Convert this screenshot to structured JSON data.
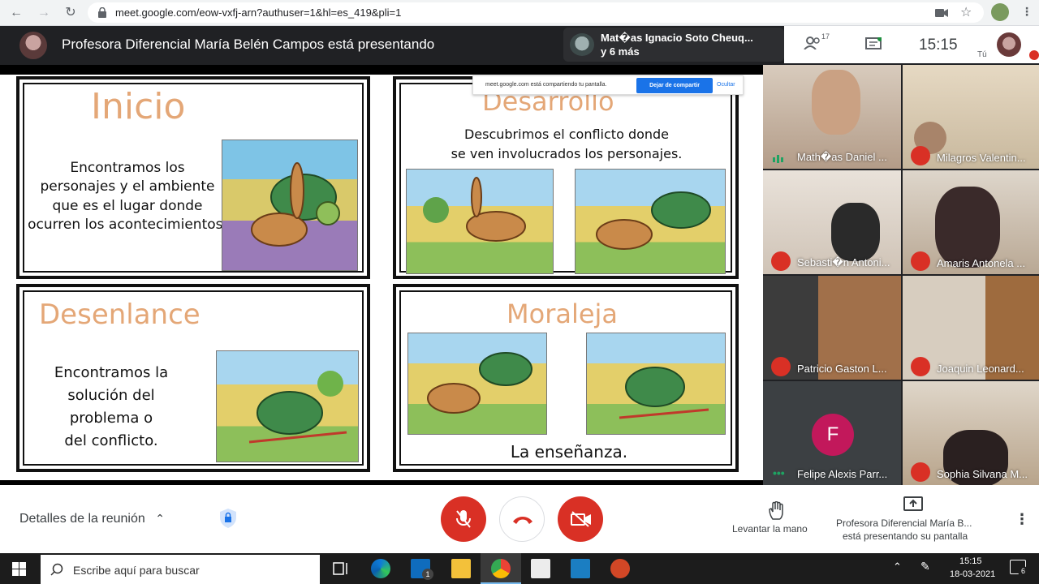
{
  "browser": {
    "url": "meet.google.com/eow-vxfj-arn?authuser=1&hl=es_419&pli=1"
  },
  "meet_header": {
    "presenter_title": "Profesora Diferencial María Belén Campos está presentando",
    "speaker_name": "Mat�as Ignacio Soto Cheuq...",
    "speaker_more": "y 6 más",
    "people_count": "17",
    "clock": "15:15",
    "you_label": "Tú"
  },
  "share_notice": {
    "text": "meet.google.com está compartiendo tu pantalla.",
    "stop_label": "Dejar de compartir",
    "hide_label": "Ocultar"
  },
  "slide": {
    "panels": [
      {
        "title": "Inicio",
        "body": [
          "Encontramos los",
          "personajes y el ambiente",
          "que es el lugar donde",
          "ocurren los acontecimientos."
        ]
      },
      {
        "title": "Desarrollo",
        "body": [
          "Descubrimos el conflicto donde",
          "se ven involucrados los personajes."
        ]
      },
      {
        "title": "Desenlance",
        "body": [
          "Encontramos la",
          "solución del",
          "problema o",
          "del conflicto."
        ]
      },
      {
        "title": "Moraleja",
        "body": [
          "La enseñanza."
        ]
      }
    ]
  },
  "participants": [
    {
      "name": "Math�as Daniel ...",
      "muted": false
    },
    {
      "name": "Milagros Valentin...",
      "muted": true
    },
    {
      "name": "Sebasti�n Antoni...",
      "muted": true
    },
    {
      "name": "Amaris Antonela ...",
      "muted": true
    },
    {
      "name": "Patricio Gaston L...",
      "muted": true
    },
    {
      "name": "Joaquin Leonard...",
      "muted": true
    },
    {
      "name": "Felipe Alexis Parr...",
      "muted": false,
      "initial": "F"
    },
    {
      "name": "Sophia Silvana M...",
      "muted": true
    }
  ],
  "controls": {
    "meeting_details": "Detalles de la reunión",
    "raise_hand": "Levantar la mano",
    "presenting_line1": "Profesora Diferencial María B...",
    "presenting_line2": "está presentando su pantalla"
  },
  "taskbar": {
    "search_placeholder": "Escribe aquí para buscar",
    "mail_badge": "1",
    "time": "15:15",
    "date": "18-03-2021",
    "notification_count": "6"
  },
  "colors": {
    "meet_dark": "#202124",
    "end_call_red": "#d93025",
    "slide_title": "#e4a777",
    "accent_blue": "#1a73e8",
    "avatar_pink": "#c2185b"
  }
}
